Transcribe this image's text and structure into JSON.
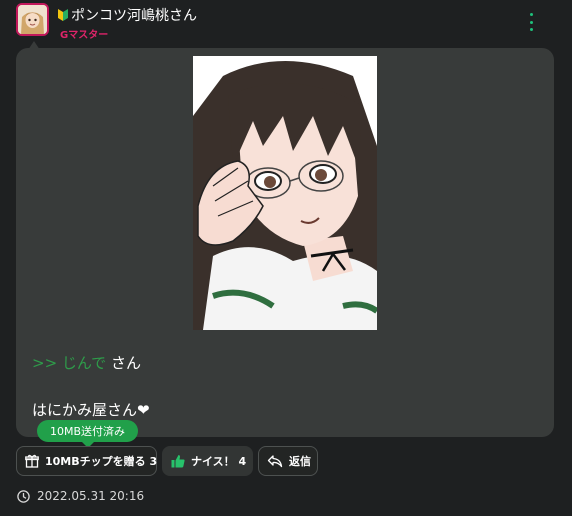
{
  "post": {
    "username": "ポンコツ河嶋桃さん",
    "rank": "Gマスター",
    "reply_mark": ">> じんで",
    "reply_suffix": "さん",
    "message": "はにかみ屋さん❤"
  },
  "actions": {
    "tip_tooltip": "10MB送付済み",
    "tip_label": "10MBチップを贈る 3",
    "nice_label": "ナイス！ 4",
    "reply_label": "返信"
  },
  "meta": {
    "timestamp": "2022.05.31 20:16"
  },
  "icons": {
    "avatar": "avatar-image",
    "beginner": "beginner-mark-icon",
    "menu": "kebab-menu-icon",
    "tip": "gift-icon",
    "nice": "thumbs-up-icon",
    "reply": "reply-arrow-icon",
    "time": "clock-icon"
  },
  "colors": {
    "accent_green": "#21a04a",
    "rank_pink": "#e0246a",
    "reply_green": "#2e9c4a",
    "bubble": "#383b3a",
    "background": "#1e2021"
  }
}
